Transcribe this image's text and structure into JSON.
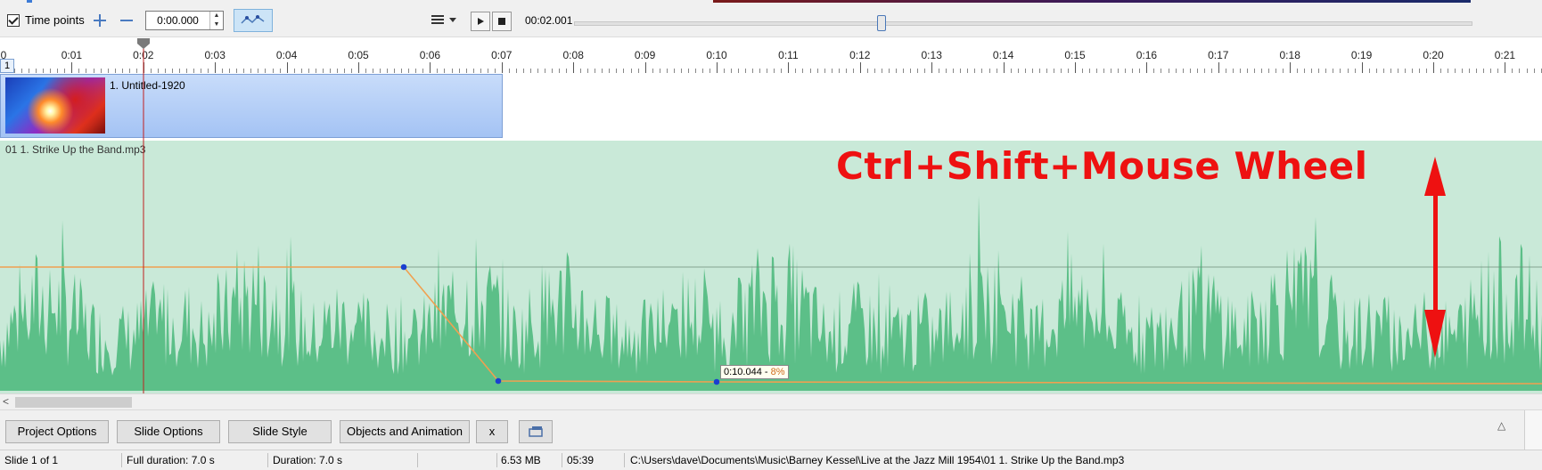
{
  "toolbar": {
    "timepoints_label": "Time points",
    "time_value": "0:00.000",
    "play_time": "00:02.001",
    "playback_position": 0.34
  },
  "ruler": {
    "labels": [
      "0",
      "0:01",
      "0:02",
      "0:03",
      "0:04",
      "0:05",
      "0:06",
      "0:07",
      "0:08",
      "0:09",
      "0:10",
      "0:11",
      "0:12",
      "0:13",
      "0:14",
      "0:15",
      "0:16",
      "0:17",
      "0:18",
      "0:19",
      "0:20",
      "0:21"
    ],
    "playhead_seconds": 2.0
  },
  "slide": {
    "number": "1",
    "title": "1. Untitled-1920"
  },
  "audio": {
    "title": "01 1. Strike Up the Band.mp3",
    "callout": "Ctrl+Shift+Mouse Wheel",
    "tooltip_time": "0:10.044 - ",
    "tooltip_percent": "8%",
    "envelope_points": [
      {
        "t": 5.65,
        "volume": 0.48
      },
      {
        "t": 6.98,
        "volume": 0.05
      },
      {
        "t": 10.044,
        "volume": 0.04
      }
    ]
  },
  "buttons": {
    "project_options": "Project Options",
    "slide_options": "Slide Options",
    "slide_style": "Slide Style",
    "objects_animation": "Objects and Animation",
    "close": "x"
  },
  "status": {
    "slide": "Slide 1 of 1",
    "full_duration": "Full duration: 7.0 s",
    "duration": "Duration: 7.0 s",
    "size": "6.53 MB",
    "length": "05:39",
    "path": "C:\\Users\\dave\\Documents\\Music\\Barney Kessel\\Live at the Jazz Mill 1954\\01 1. Strike Up the Band.mp3"
  },
  "colors": {
    "waveform": "#5cbf88",
    "audio_bg": "#c9e9d8",
    "envelope": "#f0a050",
    "callout": "#ee1111",
    "slide_block": "#b4cdf6"
  }
}
